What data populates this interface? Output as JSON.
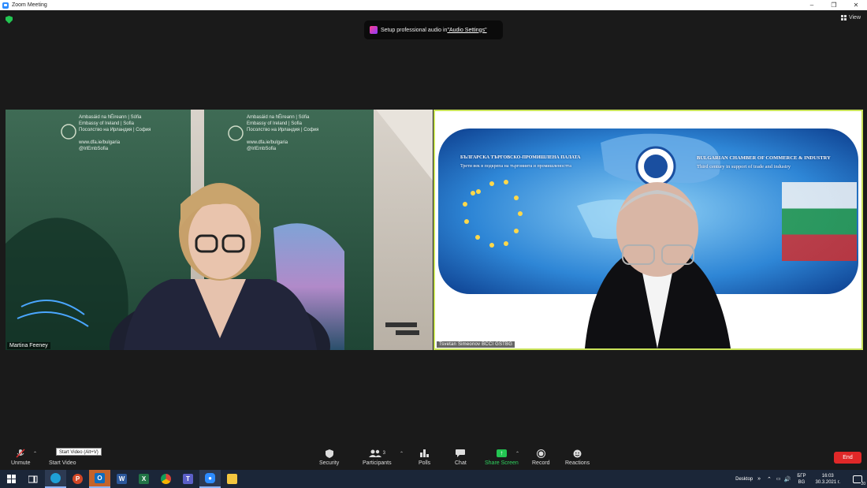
{
  "window": {
    "title": "Zoom Meeting"
  },
  "top": {
    "toast_prefix": "Setup professional audio in ",
    "toast_link": "\"Audio Settings\"",
    "view_label": "View"
  },
  "tiles": {
    "left": {
      "name": "Martina Feeney",
      "banner": {
        "line1": "Ambasáid na hÉireann | Sófia",
        "line2": "Embassy of Ireland | Sofia",
        "line3": "Посолство на Ирландия | София",
        "web": "www.dfa.ie/bulgaria",
        "twitter": "@IrlEmbSofia"
      }
    },
    "right": {
      "name": "Tsvetan Simeonov BCCI GSTBG",
      "banner": {
        "bg_title": "БЪЛГАРСКА ТЪРГОВСКО-ПРОМИШЛЕНА ПАЛАТА",
        "bg_sub": "Трети век в подкрепа на търговията и промишлеността",
        "en_title": "BULGARIAN CHAMBER OF COMMERCE & INDUSTRY",
        "en_sub": "Third century in support of trade and industry"
      }
    }
  },
  "toolbar": {
    "unmute": "Unmute",
    "start_video": "Start Video",
    "tooltip": "Start Video (Alt+V)",
    "security": "Security",
    "participants": "Participants",
    "participants_count": "3",
    "polls": "Polls",
    "chat": "Chat",
    "share_screen": "Share Screen",
    "record": "Record",
    "reactions": "Reactions",
    "end": "End"
  },
  "taskbar": {
    "desktop": "Desktop",
    "lang_top": "БГР",
    "lang_bottom": "BG",
    "time": "16:03",
    "date": "30.3.2021 г.",
    "notifications": "20"
  },
  "colors": {
    "active_speaker_border": "#c9e35a",
    "end_button": "#e02828",
    "share_green": "#23c552",
    "taskbar": "#1b2638"
  }
}
